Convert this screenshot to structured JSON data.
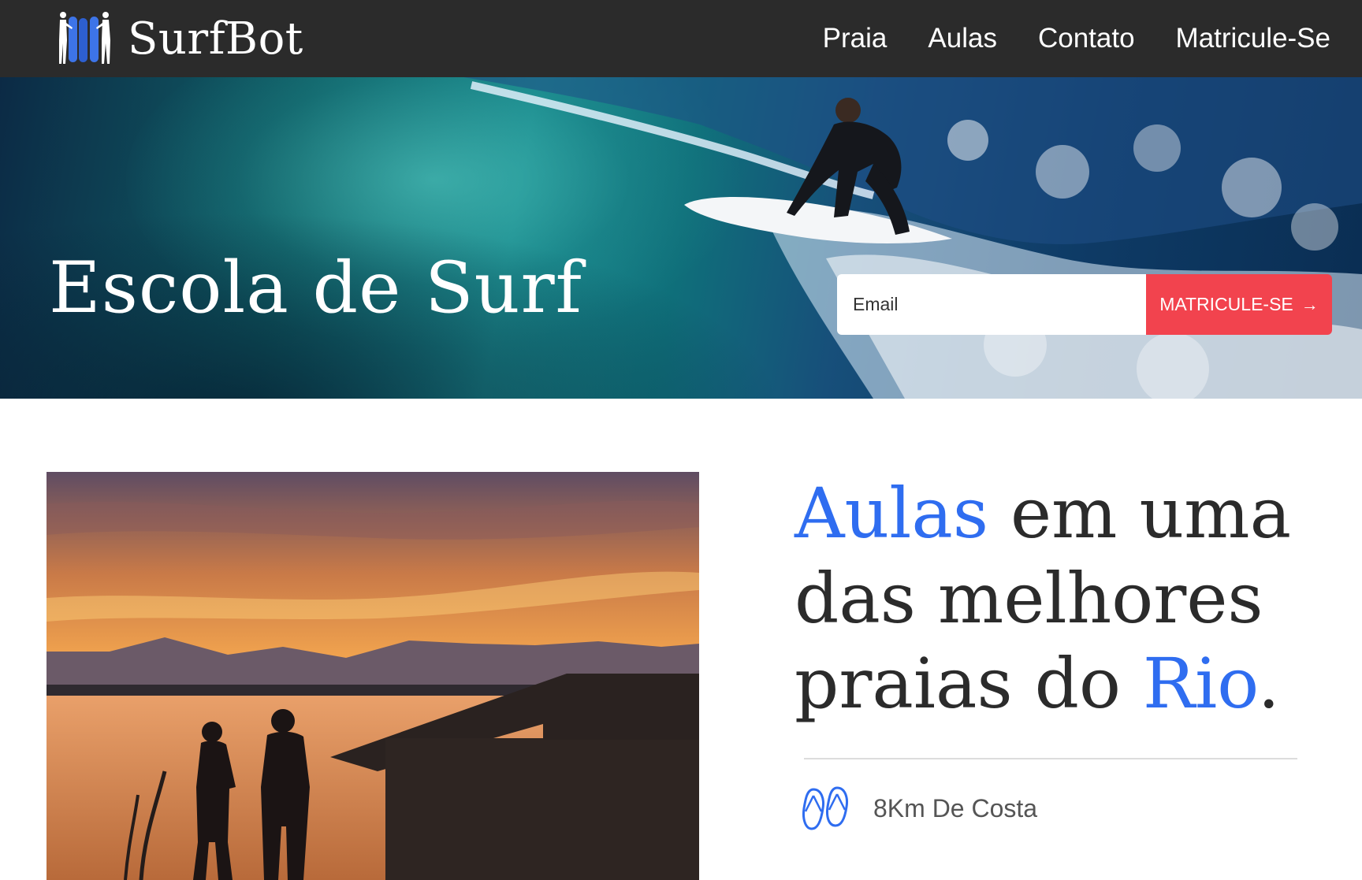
{
  "header": {
    "brand": "SurfBot",
    "logo_icon": "surfers-with-boards-icon",
    "nav": [
      "Praia",
      "Aulas",
      "Contato",
      "Matricule-Se"
    ]
  },
  "hero": {
    "title": "Escola de Surf",
    "email_placeholder": "Email",
    "cta_label": "MATRICULE-SE",
    "cta_icon": "arrow-right-icon",
    "cta_color": "#f2434e"
  },
  "content": {
    "headline": {
      "part1": "Aulas",
      "part2": " em uma das melhores praias do ",
      "part3": "Rio",
      "part4": "."
    },
    "accent_color": "#2f6df0",
    "feature": {
      "icon": "flip-flops-icon",
      "text": "8Km De Costa"
    }
  }
}
